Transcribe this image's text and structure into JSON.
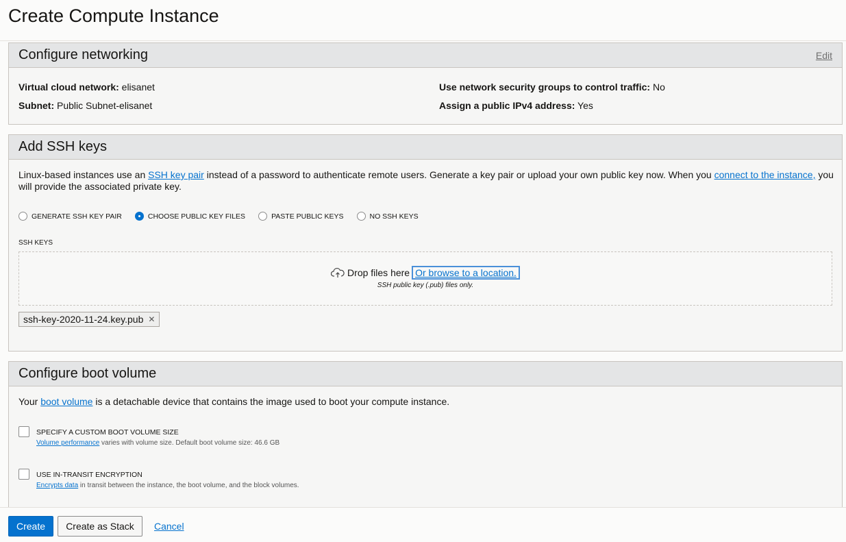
{
  "page": {
    "title": "Create Compute Instance"
  },
  "networking": {
    "title": "Configure networking",
    "edit_label": "Edit",
    "vcn_label": "Virtual cloud network:",
    "vcn_value": "elisanet",
    "subnet_label": "Subnet:",
    "subnet_value": "Public Subnet-elisanet",
    "nsg_label": "Use network security groups to control traffic:",
    "nsg_value": "No",
    "ipv4_label": "Assign a public IPv4 address:",
    "ipv4_value": "Yes"
  },
  "ssh": {
    "title": "Add SSH keys",
    "desc_before": "Linux-based instances use an ",
    "desc_link1": "SSH key pair",
    "desc_middle": " instead of a password to authenticate remote users. Generate a key pair or upload your own public key now. When you ",
    "desc_link2": "connect to the instance,",
    "desc_after": " you will provide the associated private key.",
    "options": [
      {
        "label": "GENERATE SSH KEY PAIR",
        "selected": false
      },
      {
        "label": "CHOOSE PUBLIC KEY FILES",
        "selected": true
      },
      {
        "label": "PASTE PUBLIC KEYS",
        "selected": false
      },
      {
        "label": "NO SSH KEYS",
        "selected": false
      }
    ],
    "keys_label": "SSH KEYS",
    "drop_text": "Drop files here",
    "browse_text": "Or browse to a location.",
    "hint": "SSH public key (.pub) files only.",
    "file_chip": "ssh-key-2020-11-24.key.pub"
  },
  "boot": {
    "title": "Configure boot volume",
    "desc_before": "Your ",
    "desc_link": "boot volume",
    "desc_after": " is a detachable device that contains the image used to boot your compute instance.",
    "custom_size_label": "SPECIFY A CUSTOM BOOT VOLUME SIZE",
    "custom_size_link": "Volume performance",
    "custom_size_sub": " varies with volume size. Default boot volume size: 46.6 GB",
    "encryption_label": "USE IN-TRANSIT ENCRYPTION",
    "encryption_link": "Encrypts data",
    "encryption_sub": " in transit between the instance, the boot volume, and the block volumes."
  },
  "footer": {
    "create_label": "Create",
    "stack_label": "Create as Stack",
    "cancel_label": "Cancel"
  },
  "colors": {
    "accent": "#0572ce",
    "header_bg": "#e4e5e6"
  }
}
